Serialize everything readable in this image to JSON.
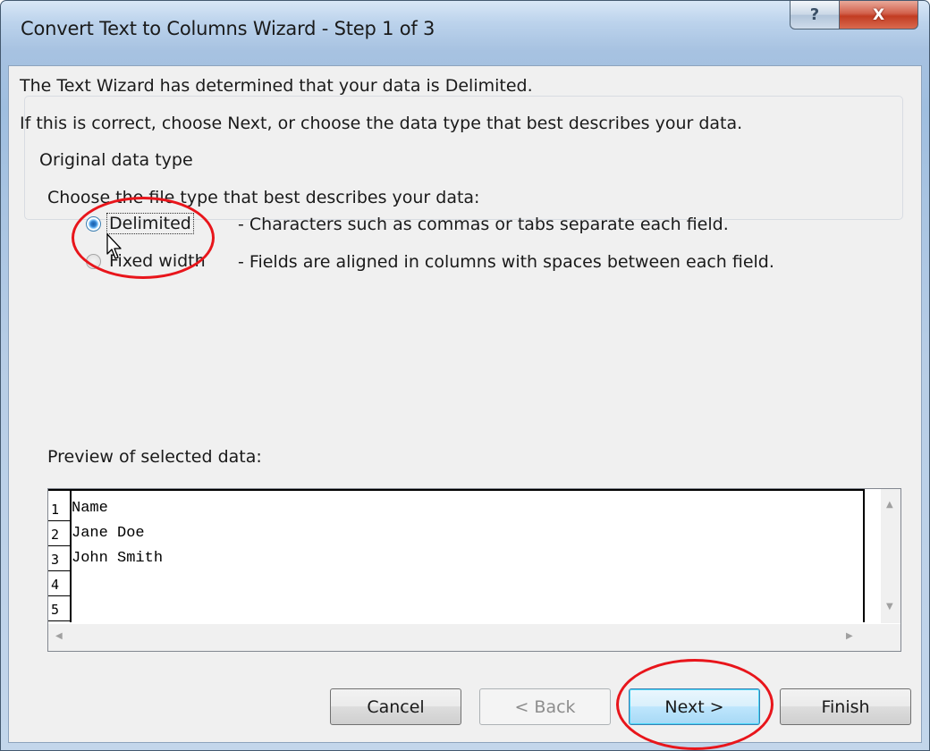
{
  "window": {
    "title": "Convert Text to Columns Wizard - Step 1 of 3"
  },
  "caption_buttons": {
    "help": "?",
    "close": "X"
  },
  "intro": {
    "line1": "The Text Wizard has determined that your data is Delimited.",
    "line2": "If this is correct, choose Next, or choose the data type that best describes your data."
  },
  "data_type_group": {
    "label": "Original data type",
    "prompt": "Choose the file type that best describes your data:",
    "options": [
      {
        "label": "Delimited",
        "description": "- Characters such as commas or tabs separate each field.",
        "selected": true
      },
      {
        "label": "Fixed width",
        "description": "- Fields are aligned in columns with spaces between each field.",
        "selected": false
      }
    ]
  },
  "preview": {
    "label": "Preview of selected data:",
    "rows": [
      {
        "num": "1",
        "text": "Name"
      },
      {
        "num": "2",
        "text": "Jane Doe"
      },
      {
        "num": "3",
        "text": "John Smith"
      },
      {
        "num": "4",
        "text": ""
      },
      {
        "num": "5",
        "text": ""
      }
    ]
  },
  "buttons": {
    "cancel": "Cancel",
    "back": "< Back",
    "next": "Next >",
    "finish": "Finish"
  },
  "colors": {
    "annotation": "#e8151b",
    "window_frame": "#a7c2e1",
    "dialog_bg": "#f0f0f0"
  }
}
